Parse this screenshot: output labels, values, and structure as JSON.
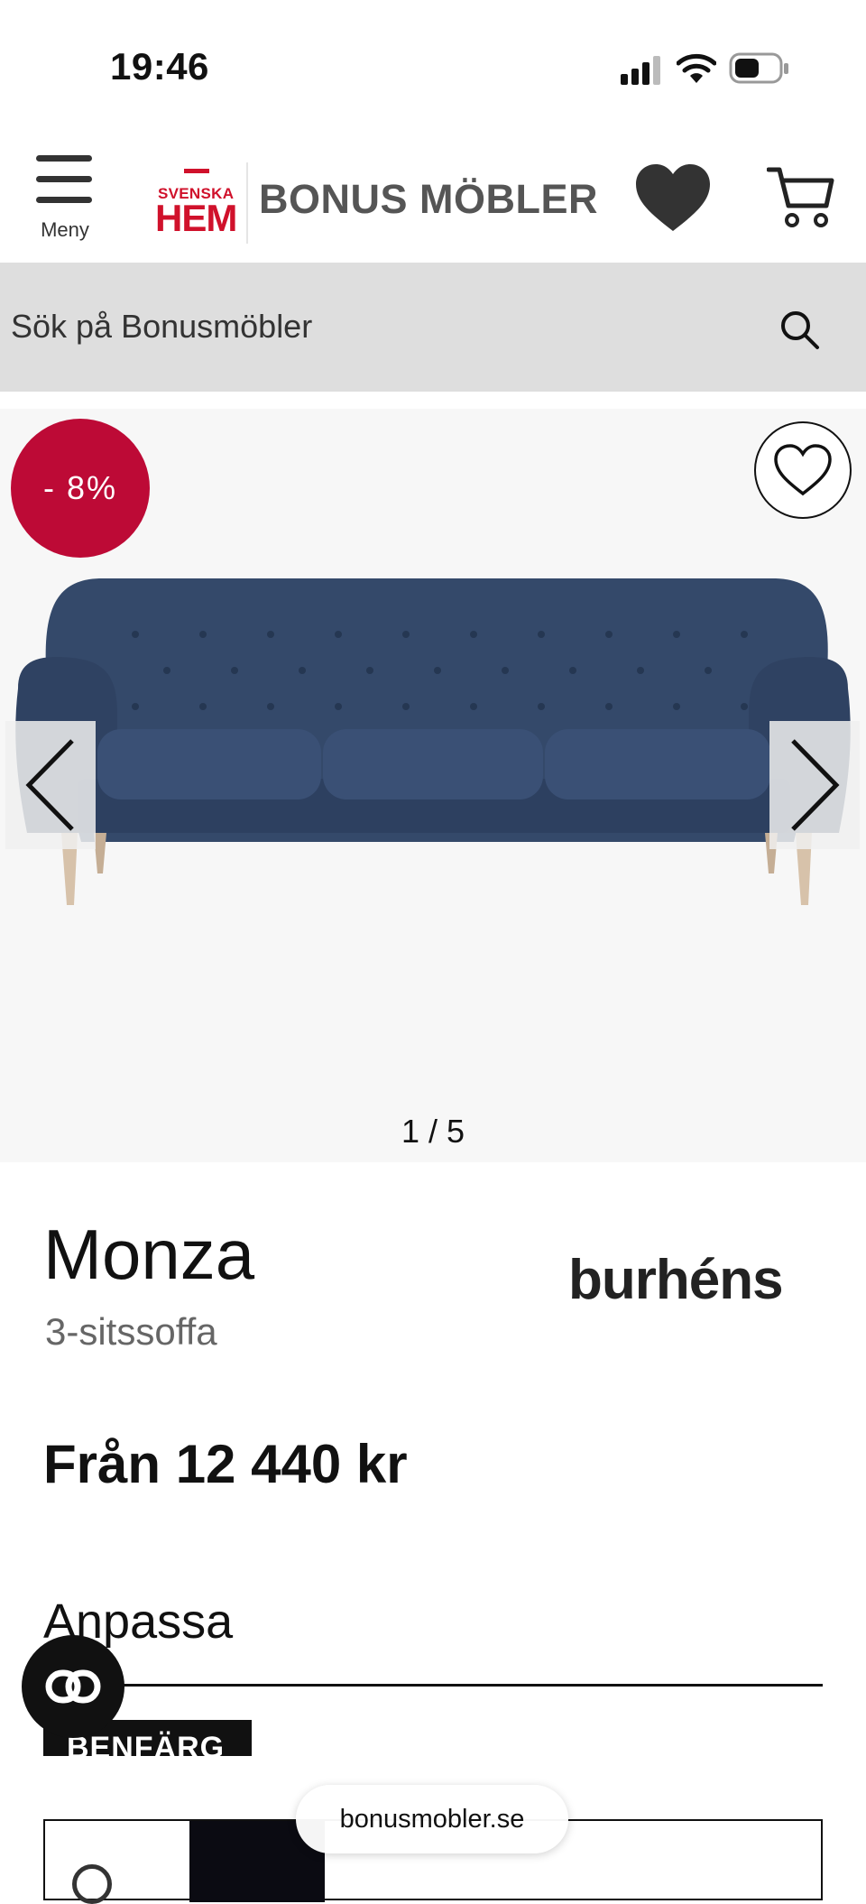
{
  "status_bar": {
    "time": "19:46"
  },
  "header": {
    "menu_label": "Meny",
    "logo_top": "SVENSKA",
    "logo_main": "HEM",
    "logo_text": "BONUS MÖBLER"
  },
  "search": {
    "placeholder": "Sök på Bonusmöbler"
  },
  "gallery": {
    "discount": "- 8%",
    "counter": "1 / 5"
  },
  "product": {
    "name": "Monza",
    "type": "3-sitssoffa",
    "brand": "burhéns",
    "price": "Från 12 440 kr"
  },
  "customize": {
    "title": "Anpassa",
    "tab_label": "BENFÄRG"
  },
  "browser": {
    "url": "bonusmobler.se"
  },
  "colors": {
    "accent": "#bd0a36",
    "brand_red": "#d0112b",
    "sofa": "#34496a"
  }
}
